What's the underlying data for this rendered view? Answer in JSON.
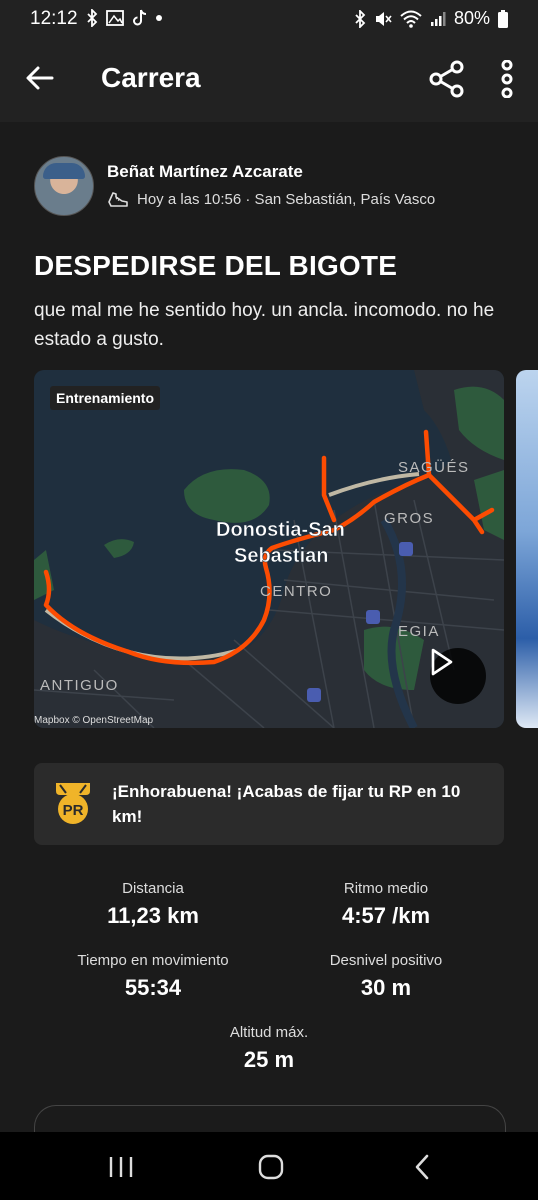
{
  "status": {
    "time": "12:12",
    "battery": "80%",
    "left_icons": [
      "bluetooth-icon",
      "gallery-icon",
      "tiktok-icon",
      "dot-icon"
    ],
    "right_icons": [
      "bluetooth-icon",
      "mute-icon",
      "wifi-icon",
      "signal-icon",
      "battery-icon"
    ]
  },
  "appbar": {
    "title": "Carrera"
  },
  "post": {
    "athlete": "Beñat Martínez Azcarate",
    "meta": "Hoy a las 10:56 · San Sebastián, País Vasco",
    "title": "DESPEDIRSE DEL BIGOTE",
    "description": "que mal me he sentido hoy. un ancla. incomodo. no he estado a gusto."
  },
  "map": {
    "tag": "Entrenamiento",
    "attribution": "Mapbox © OpenStreetMap",
    "labels": {
      "city1": "Donostia-San",
      "city2": "Sebastian",
      "sagues": "SAGÜÉS",
      "gros": "GROS",
      "centro": "CENTRO",
      "egia": "EGIA",
      "antiguo": "ANTIGUO"
    },
    "route_color": "#fc4c02"
  },
  "achievement": {
    "badge": "PR",
    "message": "¡Enhorabuena! ¡Acabas de fijar tu RP en 10 km!"
  },
  "stats": {
    "distance": {
      "label": "Distancia",
      "value": "11,23 km"
    },
    "pace": {
      "label": "Ritmo medio",
      "value": "4:57 /km"
    },
    "moving_time": {
      "label": "Tiempo en movimiento",
      "value": "55:34"
    },
    "elevation": {
      "label": "Desnivel positivo",
      "value": "30 m"
    },
    "max_altitude": {
      "label": "Altitud máx.",
      "value": "25 m"
    }
  },
  "colors": {
    "accent": "#fc4c02",
    "background": "#1b1b1b",
    "card": "#2b2b2b",
    "pr_badge": "#f0b429"
  }
}
